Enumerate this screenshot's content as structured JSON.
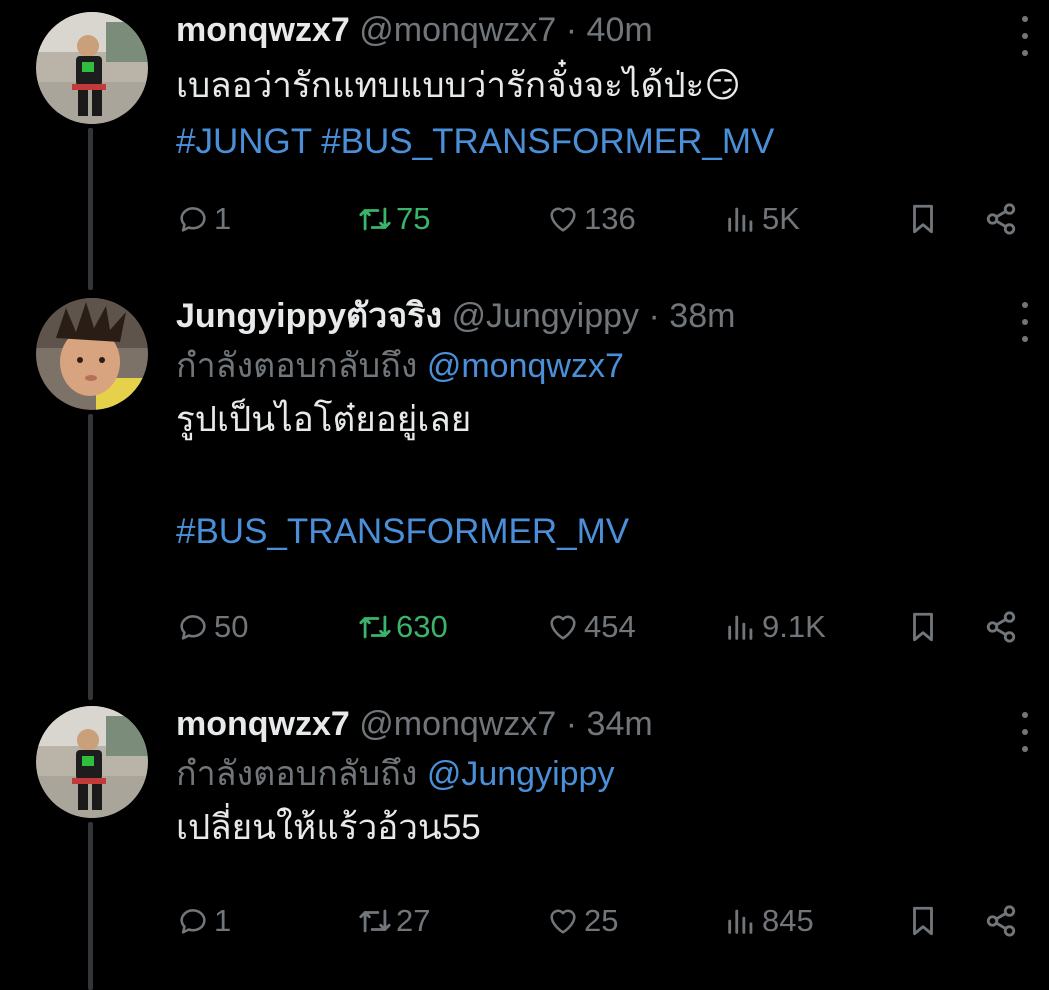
{
  "tweets": [
    {
      "name": "monqwzx7",
      "handle": "@monqwzx7",
      "dot": "·",
      "time": "40m",
      "replying_prefix": "",
      "replying_to": "",
      "text": "เบลอว่ารักแทบแบบว่ารักจั๋งจะได้ป่ะ😏",
      "hashtags": "#JUNGT #BUS_TRANSFORMER_MV",
      "replies": "1",
      "retweets": "75",
      "likes": "136",
      "views": "5K",
      "retweeted": true
    },
    {
      "name": "Jungyippyตัวจริง",
      "handle": "@Jungyippy",
      "dot": "·",
      "time": "38m",
      "replying_prefix": "กำลังตอบกลับถึง",
      "replying_to": "@monqwzx7",
      "text": "รูปเป็นไอโต๋ยอยู่เลย",
      "hashtags": "#BUS_TRANSFORMER_MV",
      "replies": "50",
      "retweets": "630",
      "likes": "454",
      "views": "9.1K",
      "retweeted": true
    },
    {
      "name": "monqwzx7",
      "handle": "@monqwzx7",
      "dot": "·",
      "time": "34m",
      "replying_prefix": "กำลังตอบกลับถึง",
      "replying_to": "@Jungyippy",
      "text": "เปลี่ยนให้แร้วอ้วน55",
      "hashtags": "",
      "replies": "1",
      "retweets": "27",
      "likes": "25",
      "views": "845",
      "retweeted": false
    }
  ],
  "icons": {
    "reply": "speech-bubble-icon",
    "retweet": "retweet-icon",
    "like": "heart-icon",
    "views": "bar-chart-icon",
    "bookmark": "bookmark-icon",
    "share": "share-icon",
    "more": "more-dots-icon"
  },
  "colors": {
    "background": "#000000",
    "text": "#e7e9ea",
    "muted": "#71767b",
    "link": "#4a8fd8",
    "retweet_active": "#3bb36a"
  }
}
